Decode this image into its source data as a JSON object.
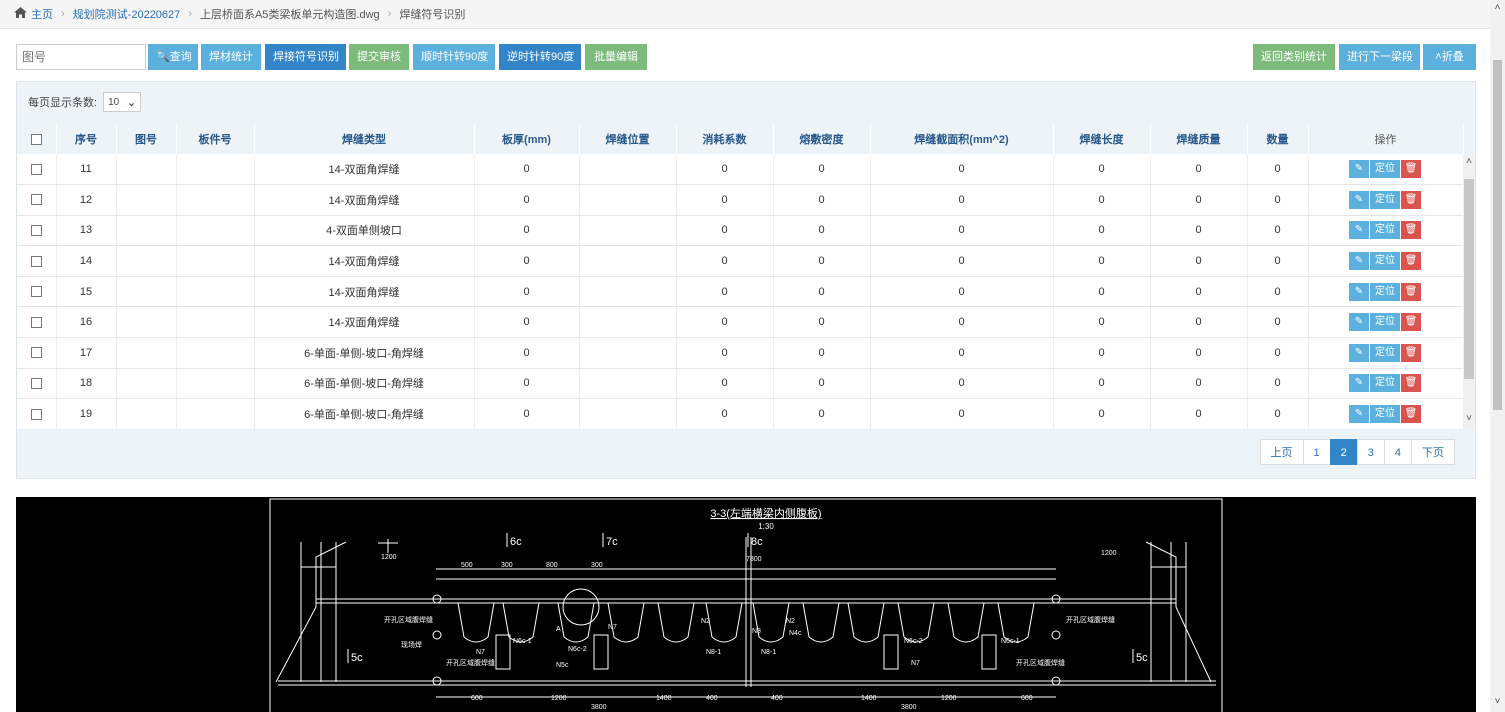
{
  "breadcrumb": {
    "home_icon": "home-icon",
    "items": [
      "主页",
      "规划院测试-20220627",
      "上层桥面系A5类梁板单元构造图.dwg",
      "焊缝符号识别"
    ]
  },
  "toolbar": {
    "search_placeholder": "图号",
    "query_label": "查询",
    "weld_material_stats": "焊材统计",
    "weld_symbol_recognition": "焊接符号识别",
    "submit_review": "提交审核",
    "rotate_cw": "顺时针转90度",
    "rotate_ccw": "逆时针转90度",
    "batch_edit": "批量编辑",
    "back_to_category_stats": "返回类别统计",
    "next_segment": "进行下一梁段",
    "collapse": "折叠"
  },
  "page_size": {
    "label": "每页显示条数:",
    "value": "10"
  },
  "table": {
    "headers": [
      "序号",
      "图号",
      "板件号",
      "焊缝类型",
      "板厚(mm)",
      "焊缝位置",
      "消耗系数",
      "熔敷密度",
      "焊缝截面积(mm^2)",
      "焊缝长度",
      "焊缝质量",
      "数量",
      "操作"
    ],
    "rows": [
      {
        "seq": "11",
        "drawing": "",
        "part": "",
        "type": "14-双面角焊缝",
        "thickness": "0",
        "position": "",
        "consumption": "0",
        "density": "0",
        "area": "0",
        "length": "0",
        "mass": "0",
        "qty": "0"
      },
      {
        "seq": "12",
        "drawing": "",
        "part": "",
        "type": "14-双面角焊缝",
        "thickness": "0",
        "position": "",
        "consumption": "0",
        "density": "0",
        "area": "0",
        "length": "0",
        "mass": "0",
        "qty": "0"
      },
      {
        "seq": "13",
        "drawing": "",
        "part": "",
        "type": "4-双面单侧坡口",
        "thickness": "0",
        "position": "",
        "consumption": "0",
        "density": "0",
        "area": "0",
        "length": "0",
        "mass": "0",
        "qty": "0"
      },
      {
        "seq": "14",
        "drawing": "",
        "part": "",
        "type": "14-双面角焊缝",
        "thickness": "0",
        "position": "",
        "consumption": "0",
        "density": "0",
        "area": "0",
        "length": "0",
        "mass": "0",
        "qty": "0"
      },
      {
        "seq": "15",
        "drawing": "",
        "part": "",
        "type": "14-双面角焊缝",
        "thickness": "0",
        "position": "",
        "consumption": "0",
        "density": "0",
        "area": "0",
        "length": "0",
        "mass": "0",
        "qty": "0"
      },
      {
        "seq": "16",
        "drawing": "",
        "part": "",
        "type": "14-双面角焊缝",
        "thickness": "0",
        "position": "",
        "consumption": "0",
        "density": "0",
        "area": "0",
        "length": "0",
        "mass": "0",
        "qty": "0"
      },
      {
        "seq": "17",
        "drawing": "",
        "part": "",
        "type": "6-单面-单侧-坡口-角焊缝",
        "thickness": "0",
        "position": "",
        "consumption": "0",
        "density": "0",
        "area": "0",
        "length": "0",
        "mass": "0",
        "qty": "0"
      },
      {
        "seq": "18",
        "drawing": "",
        "part": "",
        "type": "6-单面-单侧-坡口-角焊缝",
        "thickness": "0",
        "position": "",
        "consumption": "0",
        "density": "0",
        "area": "0",
        "length": "0",
        "mass": "0",
        "qty": "0"
      },
      {
        "seq": "19",
        "drawing": "",
        "part": "",
        "type": "6-单面-单侧-坡口-角焊缝",
        "thickness": "0",
        "position": "",
        "consumption": "0",
        "density": "0",
        "area": "0",
        "length": "0",
        "mass": "0",
        "qty": "0"
      }
    ],
    "op_locate": "定位"
  },
  "pagination": {
    "prev": "上页",
    "pages": [
      "1",
      "2",
      "3",
      "4"
    ],
    "active": "2",
    "next": "下页"
  },
  "drawing": {
    "title": "3-3(左端横梁内侧腹板)",
    "scale": "1:30",
    "section_labels": [
      "6c",
      "7c",
      "8c",
      "5c",
      "5c"
    ],
    "dimensions": [
      "1200",
      "7800",
      "1200",
      "600",
      "1200",
      "1400",
      "400",
      "400",
      "1400",
      "1200",
      "600",
      "3800",
      "3800",
      "500",
      "300",
      "800",
      "300"
    ],
    "part_labels": [
      "N7",
      "N6c-1",
      "N6c-2",
      "N7",
      "N2",
      "N2",
      "N8",
      "N4c",
      "N8-1",
      "N8-1",
      "N6c-2",
      "N7",
      "N6c-1",
      "N5c",
      "A"
    ],
    "notes": [
      "开孔区域腹焊缝",
      "开孔区域腹焊缝",
      "开孔区域腹焊缝",
      "开孔区域腹焊缝",
      "现场焊"
    ]
  },
  "colors": {
    "info": "#5bb0de",
    "primary": "#3385c9",
    "success": "#7dbb7d",
    "danger": "#d9534f",
    "link": "#2a6fb5",
    "cad_line": "#ffffff"
  }
}
